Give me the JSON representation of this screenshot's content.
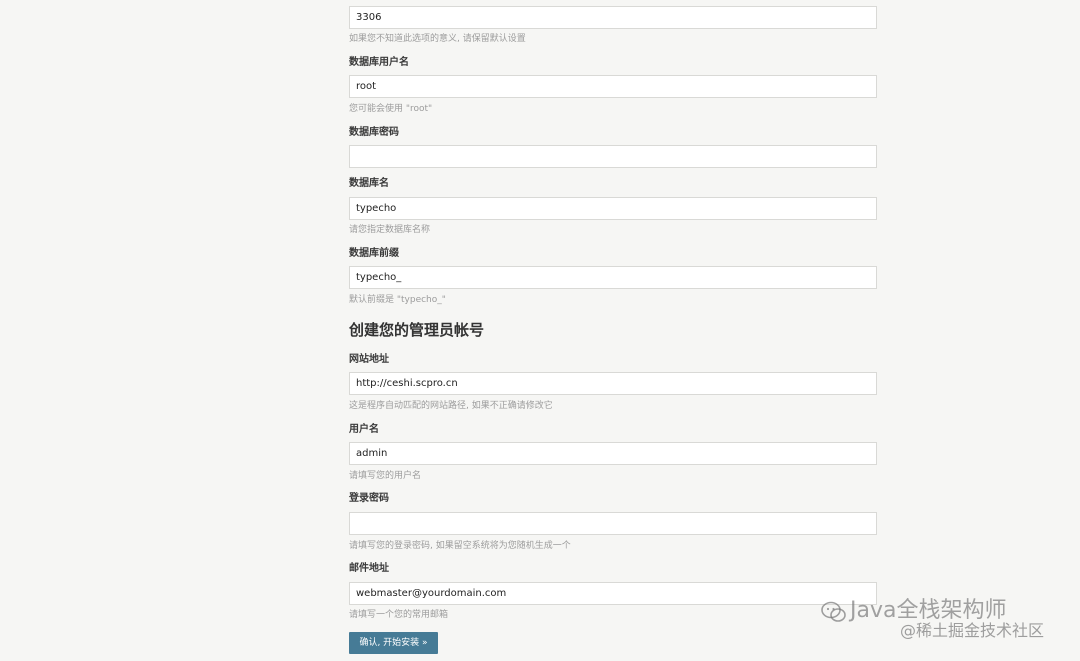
{
  "form": {
    "port": {
      "value": "3306",
      "help": "如果您不知道此选项的意义, 请保留默认设置"
    },
    "db_user": {
      "label": "数据库用户名",
      "value": "root",
      "help": "您可能会使用 \"root\""
    },
    "db_password": {
      "label": "数据库密码",
      "value": ""
    },
    "db_name": {
      "label": "数据库名",
      "value": "typecho",
      "help": "请您指定数据库名称"
    },
    "db_prefix": {
      "label": "数据库前缀",
      "value": "typecho_",
      "help": "默认前缀是 \"typecho_\""
    },
    "admin_section_title": "创建您的管理员帐号",
    "site_url": {
      "label": "网站地址",
      "value": "http://ceshi.scpro.cn",
      "help": "这是程序自动匹配的网站路径, 如果不正确请修改它"
    },
    "username": {
      "label": "用户名",
      "value": "admin",
      "help": "请填写您的用户名"
    },
    "login_password": {
      "label": "登录密码",
      "value": "",
      "help": "请填写您的登录密码, 如果留空系统将为您随机生成一个"
    },
    "email": {
      "label": "邮件地址",
      "value": "webmaster@yourdomain.com",
      "help": "请填写一个您的常用邮箱"
    },
    "submit_label": "确认, 开始安装 »"
  },
  "watermark": {
    "title": "Java全栈架构师",
    "subtitle": "@稀土掘金技术社区",
    "icon": "wechat-icon"
  },
  "colors": {
    "background": "#f6f6f4",
    "button": "#467b96",
    "help_text": "#9c9c9c"
  }
}
